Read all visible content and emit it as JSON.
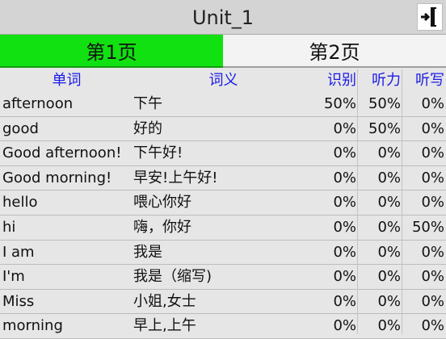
{
  "header": {
    "title": "Unit_1",
    "exit_icon": "exit-door-icon"
  },
  "tabs": [
    {
      "label": "第1页",
      "active": true
    },
    {
      "label": "第2页",
      "active": false
    }
  ],
  "columns": {
    "word": "单词",
    "definition": "词义",
    "recognize": "识别",
    "listening": "听力",
    "dictation": "听写"
  },
  "rows": [
    {
      "word": "afternoon",
      "definition": "下午",
      "recognize": "50%",
      "listening": "50%",
      "dictation": "0%"
    },
    {
      "word": "good",
      "definition": "好的",
      "recognize": "0%",
      "listening": "50%",
      "dictation": "0%"
    },
    {
      "word": "Good afternoon!",
      "definition": "下午好!",
      "recognize": "0%",
      "listening": "0%",
      "dictation": "0%"
    },
    {
      "word": "Good morning!",
      "definition": "早安!上午好!",
      "recognize": "0%",
      "listening": "0%",
      "dictation": "0%"
    },
    {
      "word": "hello",
      "definition": "喂心你好",
      "recognize": "0%",
      "listening": "0%",
      "dictation": "0%"
    },
    {
      "word": "hi",
      "definition": "嗨，你好",
      "recognize": "0%",
      "listening": "0%",
      "dictation": "50%"
    },
    {
      "word": "I am",
      "definition": "我是",
      "recognize": "0%",
      "listening": "0%",
      "dictation": "0%"
    },
    {
      "word": "I'm",
      "definition": "我是（缩写)",
      "recognize": "0%",
      "listening": "0%",
      "dictation": "0%"
    },
    {
      "word": "Miss",
      "definition": "小姐,女士",
      "recognize": "0%",
      "listening": "0%",
      "dictation": "0%"
    },
    {
      "word": "morning",
      "definition": "早上,上午",
      "recognize": "0%",
      "listening": "0%",
      "dictation": "0%"
    }
  ],
  "colors": {
    "active_tab": "#11e011",
    "header_text": "#1a1ae6"
  }
}
